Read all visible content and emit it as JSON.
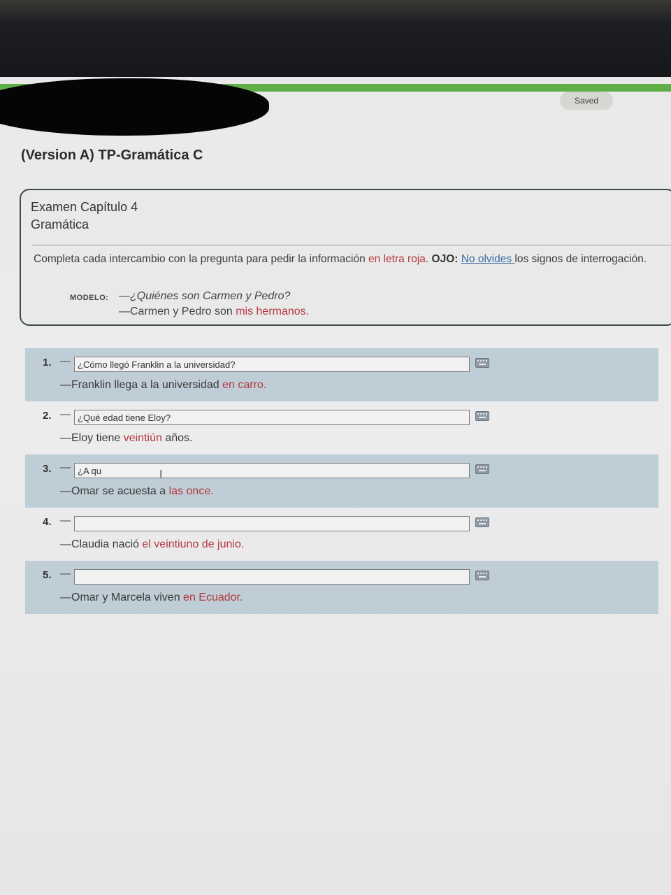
{
  "header": {
    "saved_label": "Saved"
  },
  "page": {
    "title": "(Version A) TP-Gramática C"
  },
  "exam": {
    "title": "Examen Capítulo 4",
    "section": "Gramática",
    "instructions": {
      "part1": "Completa cada intercambio con la pregunta para pedir la información ",
      "red": "en letra roja.",
      "ojo": " OJO: ",
      "link": "No olvides ",
      "part2": " los signos de interrogación."
    },
    "modelo": {
      "label": "MODELO:",
      "question": "—¿Quiénes son Carmen y Pedro?",
      "answer_pre": "—Carmen y Pedro son ",
      "answer_red": "mis hermanos."
    }
  },
  "questions": [
    {
      "number": "1.",
      "dash": "—",
      "input_value": "¿Cómo llegó Franklin a la universidad?",
      "answer_pre": "—Franklin llega a la universidad ",
      "answer_red": "en carro."
    },
    {
      "number": "2.",
      "dash": "—",
      "input_value": "¿Qué edad tiene Eloy?",
      "answer_pre": "—Eloy tiene ",
      "answer_red": "veintiún",
      "answer_post": " años."
    },
    {
      "number": "3.",
      "dash": "—",
      "input_value": "¿A qu",
      "answer_pre": "—Omar se acuesta a ",
      "answer_red": "las once."
    },
    {
      "number": "4.",
      "dash": "—",
      "input_value": "",
      "answer_pre": "—Claudia nació ",
      "answer_red": "el veintiuno de junio."
    },
    {
      "number": "5.",
      "dash": "—",
      "input_value": "",
      "answer_pre": "—Omar y Marcela viven ",
      "answer_red": "en Ecuador."
    }
  ],
  "icons": {
    "keyboard": "keyboard-icon",
    "text_cursor": "text-cursor-icon"
  },
  "colors": {
    "accent_green": "#5fae47",
    "answer_red": "#b4383e",
    "row_shade": "#bfcdd6",
    "link_blue": "#3b6ea8"
  }
}
